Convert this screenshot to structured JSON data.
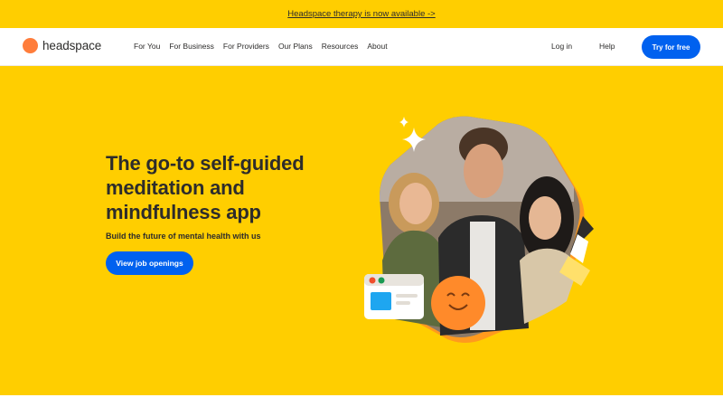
{
  "announcement": {
    "text": "Headspace therapy is now available ->"
  },
  "nav": {
    "logo_text": "headspace",
    "links": [
      "For You",
      "For Business",
      "For Providers",
      "Our Plans",
      "Resources",
      "About"
    ],
    "login": "Log in",
    "help": "Help",
    "cta": "Try for free"
  },
  "hero": {
    "title": "The go-to self-guided meditation and mindfulness app",
    "subtitle": "Build the future of mental health with us",
    "button": "View job openings"
  },
  "colors": {
    "brand_yellow": "#ffce00",
    "brand_blue": "#0061ef",
    "logo_orange": "#ff7d3b",
    "text_dark": "#2d2c2b"
  },
  "icons": {
    "logo": "orange-dot-icon",
    "sparkle": "sparkle-icon",
    "smiley": "smiley-orange-icon",
    "window": "app-window-icon",
    "pencil": "pencil-icon"
  }
}
